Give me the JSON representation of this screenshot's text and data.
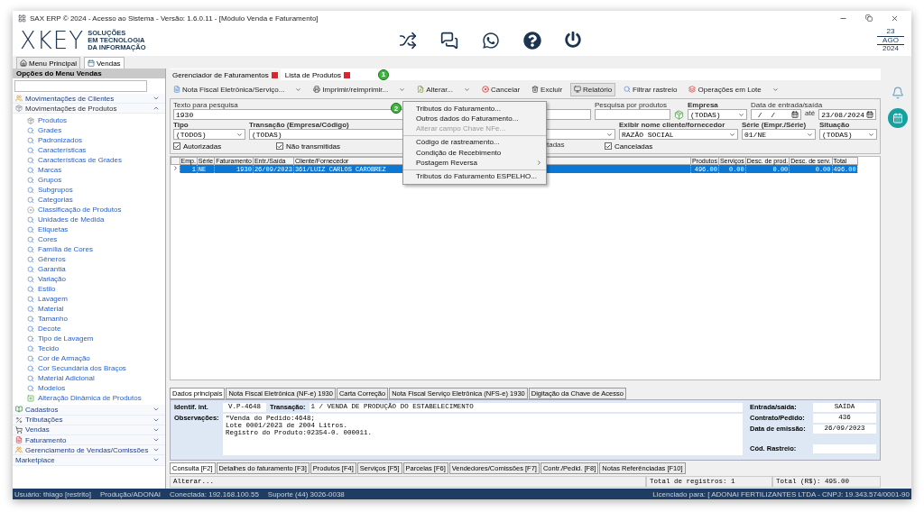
{
  "window": {
    "title": "SAX ERP © 2024 - Acesso ao Sistema - Versão: 1.6.0.11 - [Módulo Venda e Faturamento]"
  },
  "header": {
    "logo": "XKEY",
    "tagline": [
      "SOLUÇÕES",
      "EM TECNOLOGIA",
      "DA INFORMAÇÃO"
    ],
    "date": {
      "day": "23",
      "month": "AGO",
      "year": "2024"
    }
  },
  "main_tabs": [
    {
      "label": "Menu Principal",
      "selected": false
    },
    {
      "label": "Vendas",
      "selected": true
    }
  ],
  "sidebar": {
    "title": "Opções do Menu Vendas",
    "groups": [
      {
        "label": "Movimentações de Clientes",
        "kind": "clients",
        "expanded": false
      },
      {
        "label": "Movimentações de Produtos",
        "kind": "products",
        "expanded": true,
        "children": [
          {
            "label": "Produtos",
            "kind": "box"
          },
          {
            "label": "Grades",
            "kind": "search"
          },
          {
            "label": "Padronizados",
            "kind": "search"
          },
          {
            "label": "Características",
            "kind": "search"
          },
          {
            "label": "Características de Grades",
            "kind": "search"
          },
          {
            "label": "Marcas",
            "kind": "search"
          },
          {
            "label": "Grupos",
            "kind": "search"
          },
          {
            "label": "Subgrupos",
            "kind": "search"
          },
          {
            "label": "Categorias",
            "kind": "search"
          },
          {
            "label": "Classificação de Produtos",
            "kind": "disc"
          },
          {
            "label": "Unidades de Medida",
            "kind": "search"
          },
          {
            "label": "Etiquetas",
            "kind": "search"
          },
          {
            "label": "Cores",
            "kind": "search"
          },
          {
            "label": "Família de Cores",
            "kind": "search"
          },
          {
            "label": "Gêneros",
            "kind": "search"
          },
          {
            "label": "Garantia",
            "kind": "search"
          },
          {
            "label": "Variação",
            "kind": "search"
          },
          {
            "label": "Estilo",
            "kind": "search"
          },
          {
            "label": "Lavagem",
            "kind": "search"
          },
          {
            "label": "Material",
            "kind": "search"
          },
          {
            "label": "Tamanho",
            "kind": "search"
          },
          {
            "label": "Decote",
            "kind": "search"
          },
          {
            "label": "Tipo de Lavagem",
            "kind": "search"
          },
          {
            "label": "Tecido",
            "kind": "search"
          },
          {
            "label": "Cor de Armação",
            "kind": "search"
          },
          {
            "label": "Cor Secundária dos Braços",
            "kind": "search"
          },
          {
            "label": "Material Adicional",
            "kind": "search"
          },
          {
            "label": "Modelos",
            "kind": "search"
          },
          {
            "label": "Alteração Dinâmica de Produtos",
            "kind": "add"
          }
        ]
      },
      {
        "label": "Cadastros",
        "kind": "book",
        "expanded": false
      },
      {
        "label": "Tributações",
        "kind": "percent",
        "expanded": false
      },
      {
        "label": "Vendas",
        "kind": "cart",
        "expanded": false
      },
      {
        "label": "Faturamento",
        "kind": "invoice",
        "expanded": false
      },
      {
        "label": "Gerenciamento de Vendas/Comissões",
        "kind": "people",
        "expanded": false
      },
      {
        "label": "Marketplace",
        "kind": "none",
        "expanded": false
      }
    ]
  },
  "doc_tabs": [
    {
      "label": "Gerenciador de Faturamentos",
      "selected": true
    },
    {
      "label": "Lista de Produtos",
      "selected": false
    }
  ],
  "callouts": [
    "1",
    "2"
  ],
  "toolbar": [
    {
      "label": "Nota Fiscal Eletrônica/Serviço...",
      "kind": "nfe",
      "dropdown": true,
      "pressed": false
    },
    {
      "label": "Imprimir/reimprimir...",
      "kind": "print",
      "dropdown": true,
      "pressed": false
    },
    {
      "label": "Alterar...",
      "kind": "edit",
      "dropdown": true,
      "pressed": false
    },
    {
      "label": "Cancelar",
      "kind": "cancel",
      "dropdown": false,
      "pressed": false
    },
    {
      "label": "Excluir",
      "kind": "delete",
      "dropdown": false,
      "pressed": false
    },
    {
      "label": "Relatório",
      "kind": "report",
      "dropdown": false,
      "pressed": true
    },
    {
      "label": "Filtrar rastreio",
      "kind": "filter",
      "dropdown": false,
      "pressed": false
    },
    {
      "label": "Operações em Lote",
      "kind": "batch",
      "dropdown": true,
      "pressed": false
    }
  ],
  "filters": {
    "search": {
      "label": "Texto para pesquisa",
      "value": "1930"
    },
    "product_search": {
      "label": "Pesquisa por produtos"
    },
    "company": {
      "label": "Empresa",
      "value": "(TODAS)"
    },
    "date": {
      "label": "Data de entrada/saída",
      "from": " /  /",
      "to_label": "até",
      "to": "23/08/2024"
    },
    "type": {
      "label": "Tipo",
      "value": "(TODOS)"
    },
    "transaction": {
      "label": "Transação (Empresa/Código)",
      "value": "(TODAS)"
    },
    "name_display": {
      "label": "Exibir nome cliente/fornecedor",
      "value": "RAZÃO SOCIAL"
    },
    "series": {
      "label": "Série (Empr./Série)",
      "value": "01/NE"
    },
    "status": {
      "label": "Situação",
      "value": "(TODAS)"
    },
    "checkboxes": [
      {
        "label": "Autorizadas",
        "checked": true
      },
      {
        "label": "Não transmitidas",
        "checked": true
      }
    ],
    "covered_label": "tadas",
    "checkboxes_right": [
      {
        "label": "Canceladas",
        "checked": true
      }
    ]
  },
  "table": {
    "columns": [
      "Emp.",
      "Série",
      "Faturamento",
      "Entr./Saída",
      "Cliente/Fornecedor",
      "Produtos",
      "Serviços",
      "Desc. de prod.",
      "Desc. de serv.",
      "Total"
    ],
    "rows": [
      {
        "selected": true,
        "cells": [
          "1",
          "NE",
          "1930",
          "26/09/2023",
          "361/LUIZ CARLOS CAROBREZ",
          "496.00",
          "0.00",
          "0.00",
          "0.00",
          "496.00"
        ]
      }
    ]
  },
  "menu": {
    "items": [
      {
        "label": "Tributos do Faturamento...",
        "disabled": false,
        "submenu": false,
        "separator_before": false
      },
      {
        "label": "Outros dados do Faturamento...",
        "disabled": false,
        "submenu": false,
        "separator_before": false
      },
      {
        "label": "Alterar campo Chave NFe...",
        "disabled": true,
        "submenu": false,
        "separator_before": false
      },
      {
        "label": "Código de rastreamento...",
        "disabled": false,
        "submenu": false,
        "separator_before": true
      },
      {
        "label": "Condição de Recebimento",
        "disabled": false,
        "submenu": false,
        "separator_before": false
      },
      {
        "label": "Postagem Reversa",
        "disabled": false,
        "submenu": true,
        "separator_before": false
      },
      {
        "label": "Tributos do Faturamento ESPELHO...",
        "disabled": false,
        "submenu": false,
        "separator_before": true
      }
    ]
  },
  "detail_tabs": [
    {
      "label": "Dados principais",
      "selected": true
    },
    {
      "label": "Nota Fiscal Eletrônica (NF-e) 1930",
      "selected": false
    },
    {
      "label": "Carta Correção",
      "selected": false
    },
    {
      "label": "Nota Fiscal Serviço Eletrônica (NFS-e) 1930",
      "selected": false
    },
    {
      "label": "Digitação da Chave de Acesso",
      "selected": false
    }
  ],
  "detail": {
    "id_label": "Identif. int.",
    "id": "V.P-4648",
    "transaction_label": "Transação:",
    "transaction": "1 / VENDA DE PRODUÇÃO DO ESTABELECIMENTO",
    "notes_label": "Observações:",
    "notes": [
      "\"Venda do Pedido:4648;",
      "Lote 0001/2023 de 2004 Litros.",
      "Registro do Produto:02354-0. 000011."
    ],
    "fields": [
      {
        "label": "Entrada/saída:",
        "value": "SAÍDA"
      },
      {
        "label": "Contrato/Pedido:",
        "value": "436"
      },
      {
        "label": "Data de emissão:",
        "value": "26/09/2023"
      },
      {
        "label": "Cód. Rastreio:"
      }
    ]
  },
  "lower_tabs": [
    {
      "label": "Consulta [F2]",
      "selected": true
    },
    {
      "label": "Detalhes do faturamento [F3]",
      "selected": false
    },
    {
      "label": "Produtos [F4]",
      "selected": false
    },
    {
      "label": "Serviços [F5]",
      "selected": false
    },
    {
      "label": "Parcelas [F6]",
      "selected": false
    },
    {
      "label": "Vendedores/Comissões [F7]",
      "selected": false
    },
    {
      "label": "Contr./Pedid. [F8]",
      "selected": false
    },
    {
      "label": "Notas Referênciadas [F10]",
      "selected": false
    }
  ],
  "status_line": {
    "hint": "Alterar...",
    "count": "Total de registros: 1",
    "total": "Total (R$): 495.00"
  },
  "status_bar": {
    "user": "Usuário: thiago [restrito]",
    "env": "Produção/ADONAI",
    "connection": "Conectada: 192.168.100.55",
    "support": "Suporte (44) 3026-0038",
    "license": "Licenciado para: [ ADONAI FERTILIZANTES LTDA - CNPJ: 19.343.574/0001-90"
  }
}
